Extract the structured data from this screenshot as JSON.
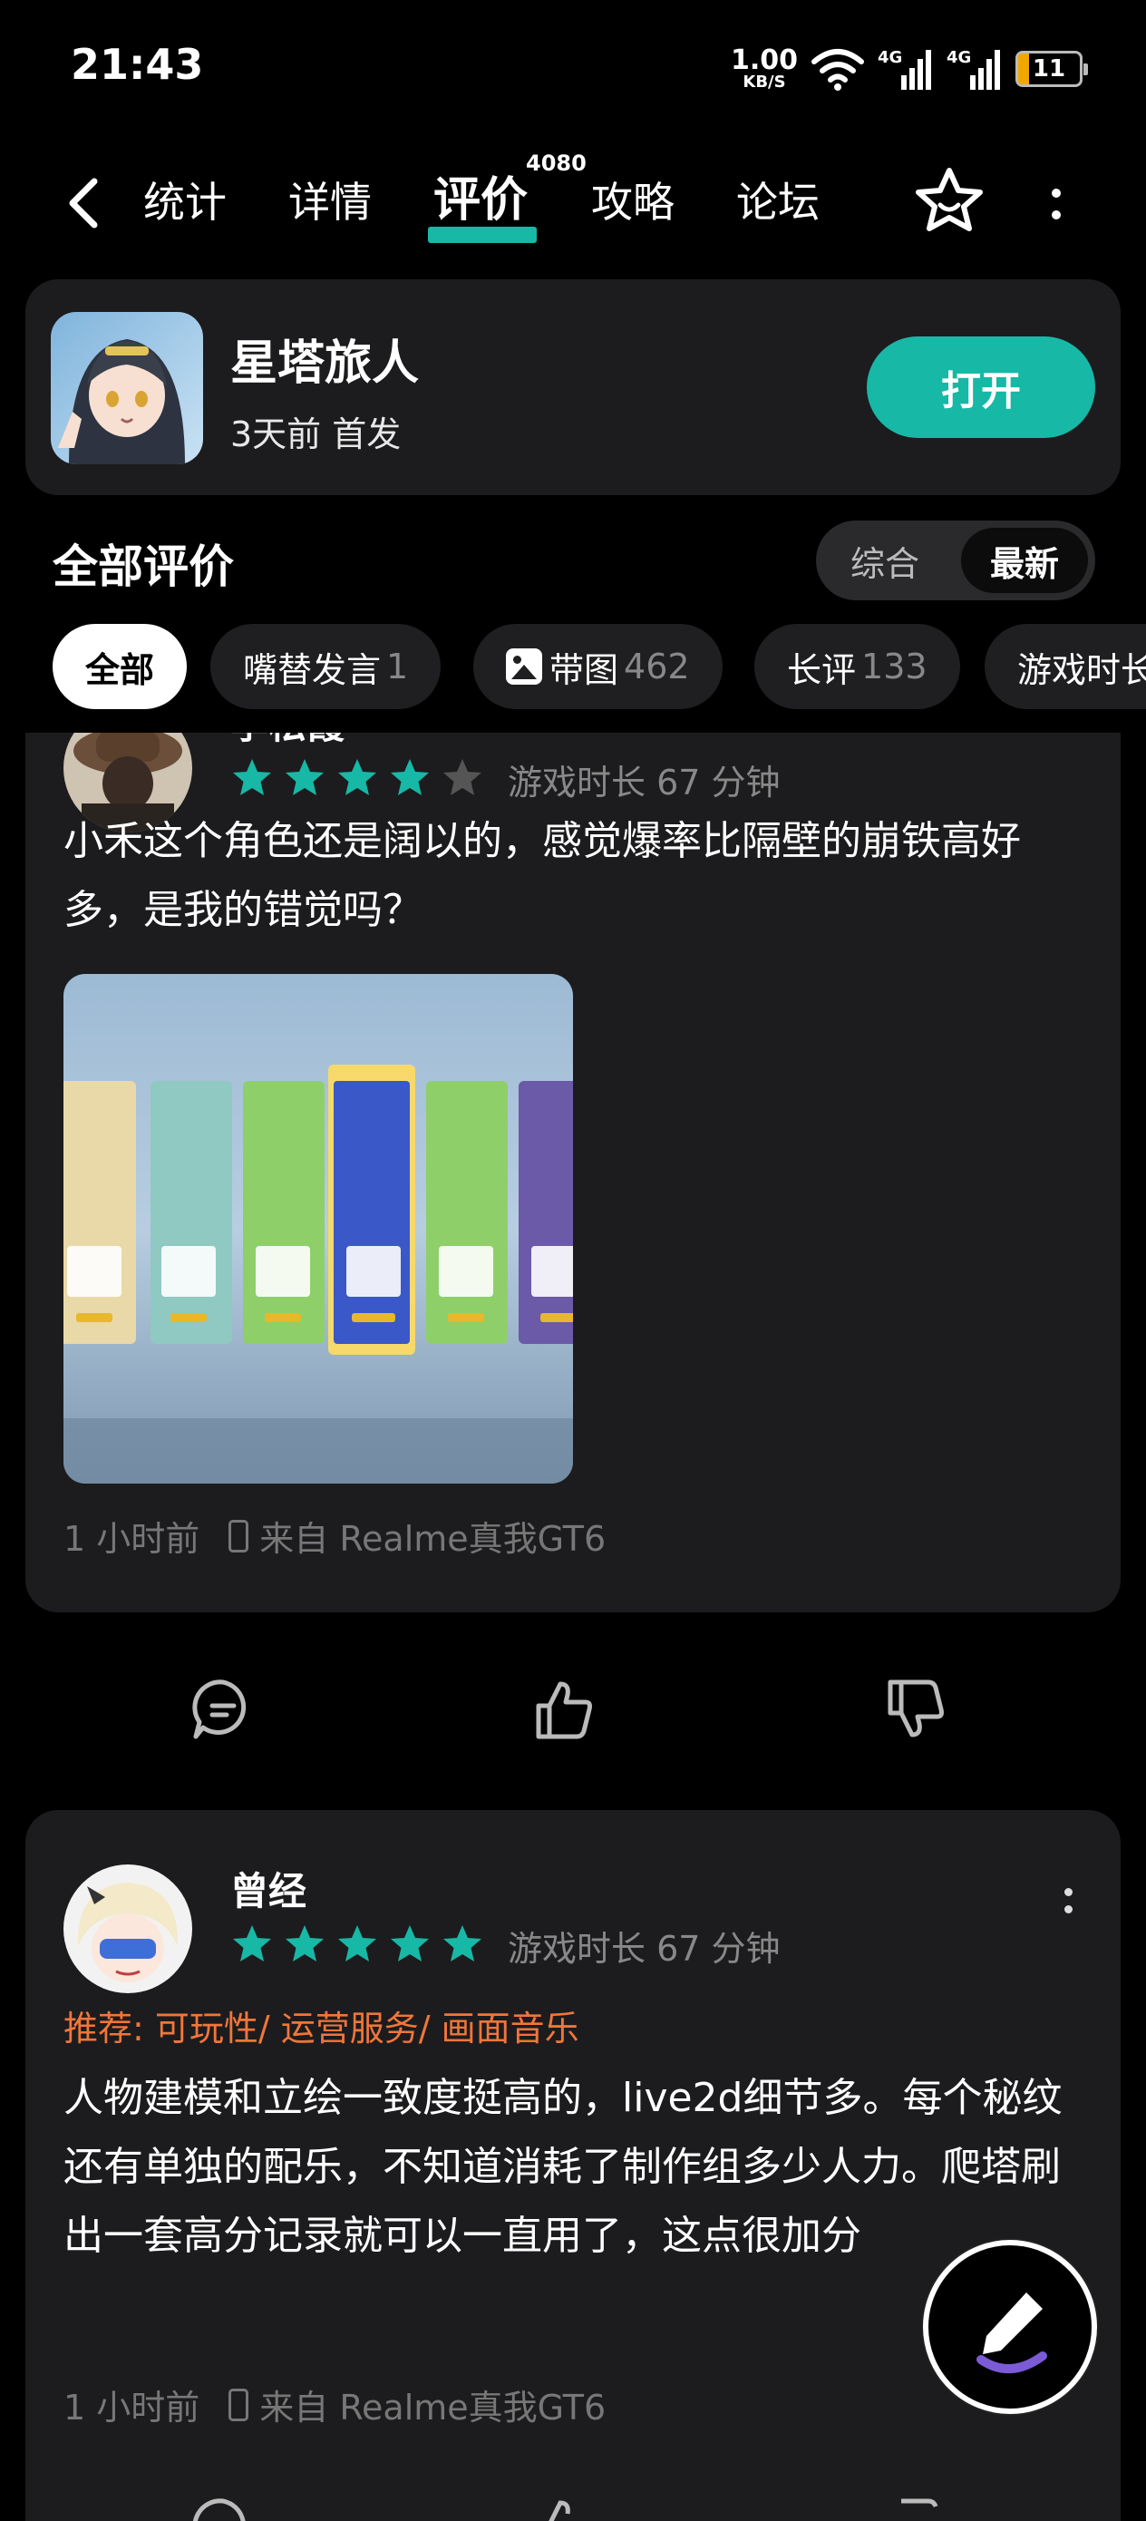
{
  "status_bar": {
    "time": "21:43",
    "net_speed_value": "1.00",
    "net_speed_unit": "KB/S",
    "signal_1_label": "4G",
    "signal_2_label": "4G",
    "battery": "11"
  },
  "nav": {
    "tabs": [
      {
        "label": "统计"
      },
      {
        "label": "详情"
      },
      {
        "label": "评价",
        "badge": "4080"
      },
      {
        "label": "攻略"
      },
      {
        "label": "论坛"
      }
    ],
    "active_tab_index": 2
  },
  "game": {
    "name": "星塔旅人",
    "subtitle": "3天前 首发",
    "open_label": "打开"
  },
  "reviews_section": {
    "title": "全部评价",
    "sort_options": [
      "综合",
      "最新"
    ],
    "sort_selected": "最新"
  },
  "filters": [
    {
      "label": "全部",
      "count": ""
    },
    {
      "label": "嘴替发言",
      "count": "1"
    },
    {
      "label": "带图",
      "count": "462"
    },
    {
      "label": "长评",
      "count": "133"
    },
    {
      "label": "游戏时长",
      "count": ""
    }
  ],
  "reviews": [
    {
      "username": "李松霞",
      "rating": 4,
      "max_rating": 5,
      "playtime": "游戏时长 67 分钟",
      "text": "小禾这个角色还是阔以的，感觉爆率比隔壁的崩铁高好多，是我的错觉吗？",
      "time": "1 小时前",
      "device": "来自 Realme真我GT6"
    },
    {
      "username": "曾经",
      "rating": 5,
      "max_rating": 5,
      "playtime": "游戏时长 67 分钟",
      "recommend": "推荐: 可玩性/ 运营服务/ 画面音乐",
      "text": "人物建模和立绘一致度挺高的，live2d细节多。每个秘纹还有单独的配乐，不知道消耗了制作组多少人力。爬塔刷出一套高分记录就可以一直用了，这点很加分",
      "time": "1 小时前",
      "device": "来自 Realme真我GT6"
    }
  ],
  "colors": {
    "accent": "#17b8a6",
    "star": "#17b8a6",
    "recommend": "#f0763a",
    "card": "#1c1c1e"
  }
}
